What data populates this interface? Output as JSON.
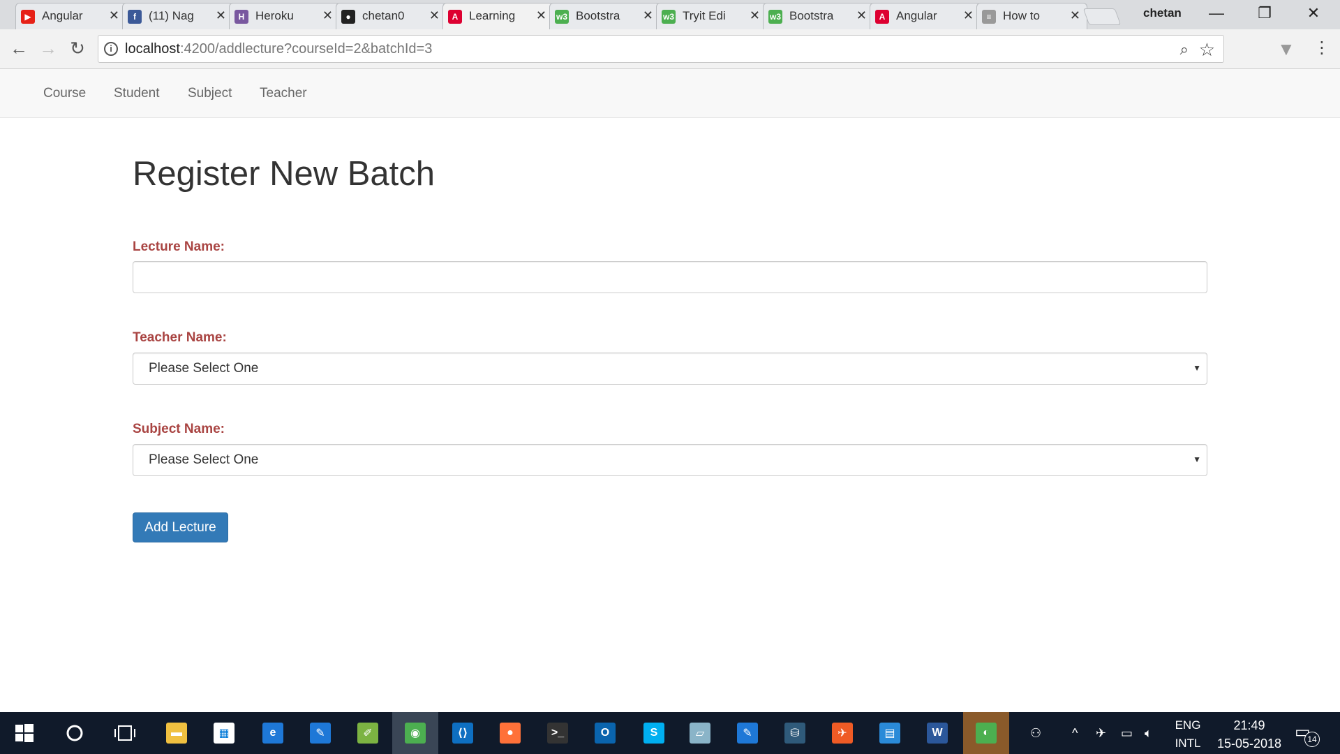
{
  "browser": {
    "tabs": [
      {
        "title": "Angular",
        "favicon": "youtube-icon",
        "color": "#e62117",
        "glyph": "▶"
      },
      {
        "title": "(11) Nag",
        "favicon": "facebook-icon",
        "color": "#3b5998",
        "glyph": "f"
      },
      {
        "title": "Heroku",
        "favicon": "heroku-icon",
        "color": "#79589f",
        "glyph": "H"
      },
      {
        "title": "chetan0",
        "favicon": "github-icon",
        "color": "#222222",
        "glyph": "●"
      },
      {
        "title": "Learning",
        "favicon": "angular-icon",
        "color": "#dd0031",
        "glyph": "A",
        "active": true
      },
      {
        "title": "Bootstra",
        "favicon": "w3schools-icon",
        "color": "#4caf50",
        "glyph": "w3"
      },
      {
        "title": "Tryit Edi",
        "favicon": "w3schools-icon",
        "color": "#4caf50",
        "glyph": "w3"
      },
      {
        "title": "Bootstra",
        "favicon": "w3schools-icon",
        "color": "#4caf50",
        "glyph": "w3"
      },
      {
        "title": "Angular",
        "favicon": "angular-icon",
        "color": "#dd0031",
        "glyph": "A"
      },
      {
        "title": "How to",
        "favicon": "page-icon",
        "color": "#999999",
        "glyph": "≡"
      }
    ],
    "profile_name": "chetan",
    "url_host": "localhost",
    "url_rest": ":4200/addlecture?courseId=2&batchId=3"
  },
  "app_nav": {
    "items": [
      "Course",
      "Student",
      "Subject",
      "Teacher"
    ]
  },
  "form": {
    "title": "Register New Batch",
    "lecture_label": "Lecture Name:",
    "lecture_value": "",
    "teacher_label": "Teacher Name:",
    "teacher_selected": "Please Select One",
    "subject_label": "Subject Name:",
    "subject_selected": "Please Select One",
    "submit_label": "Add Lecture"
  },
  "colors": {
    "label_red": "#a94442",
    "primary_button": "#337ab7",
    "taskbar": "#101a2a"
  },
  "taskbar": {
    "apps": [
      {
        "name": "file-explorer-icon",
        "color": "#f0c040",
        "glyph": "▬"
      },
      {
        "name": "store-icon",
        "color": "#ffffff",
        "glyph": "▦"
      },
      {
        "name": "edge-icon",
        "color": "#1e78d7",
        "glyph": "e"
      },
      {
        "name": "tool-icon",
        "color": "#1e78d7",
        "glyph": "✎"
      },
      {
        "name": "notepad-icon",
        "color": "#7cb342",
        "glyph": "✐"
      },
      {
        "name": "chrome-icon",
        "color": "#4caf50",
        "glyph": "◉",
        "active": true
      },
      {
        "name": "vscode-icon",
        "color": "#0e6fc1",
        "glyph": "⟨⟩"
      },
      {
        "name": "firefox-icon",
        "color": "#ff7139",
        "glyph": "●"
      },
      {
        "name": "terminal-icon",
        "color": "#333333",
        "glyph": ">_"
      },
      {
        "name": "outlook-icon",
        "color": "#0a64ad",
        "glyph": "O"
      },
      {
        "name": "skype-icon",
        "color": "#00aff0",
        "glyph": "S"
      },
      {
        "name": "notes-icon",
        "color": "#8ab4c8",
        "glyph": "▱"
      },
      {
        "name": "tool2-icon",
        "color": "#1e78d7",
        "glyph": "✎"
      },
      {
        "name": "mysql-icon",
        "color": "#2f5a7a",
        "glyph": "⛁"
      },
      {
        "name": "postman-icon",
        "color": "#ef5b25",
        "glyph": "✈"
      },
      {
        "name": "settings-panel-icon",
        "color": "#2a8ad8",
        "glyph": "▤"
      },
      {
        "name": "word-icon",
        "color": "#2b579a",
        "glyph": "W"
      },
      {
        "name": "globe-app-icon",
        "color": "#4caf50",
        "glyph": "◐",
        "active2": true
      }
    ],
    "lang_top": "ENG",
    "lang_bottom": "INTL",
    "time": "21:49",
    "date": "15-05-2018",
    "notification_count": "14"
  }
}
